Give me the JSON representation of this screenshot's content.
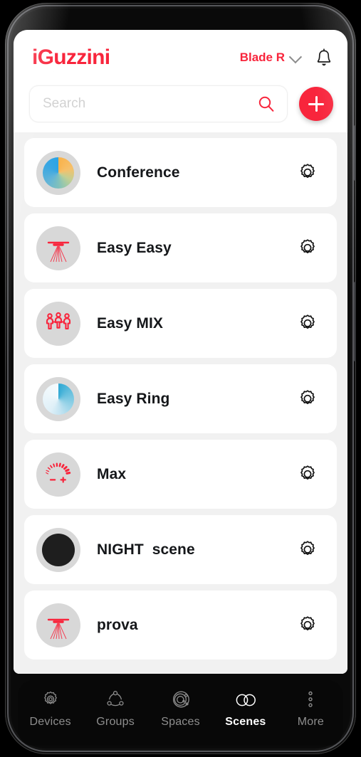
{
  "app": {
    "brand_logo_text": "iGuzzini",
    "brand_color": "#f8253c",
    "page_background": "#f1f1f1",
    "card_background": "#ffffff"
  },
  "header": {
    "project_name": "Blade R",
    "project_chevron_icon": "chevron-down-icon",
    "notifications_icon": "bell-icon"
  },
  "search": {
    "value": "",
    "placeholder": "Search",
    "search_icon": "search-icon",
    "add_label": "+",
    "add_icon": "plus-icon"
  },
  "scenes": [
    {
      "label": "Conference",
      "thumb_icon": "pie-chart-warm-cool-icon",
      "settings_icon": "gear-icon"
    },
    {
      "label": "Easy Easy",
      "thumb_icon": "downlight-beam-icon",
      "settings_icon": "gear-icon"
    },
    {
      "label": "Easy MIX",
      "thumb_icon": "people-group-icon",
      "settings_icon": "gear-icon"
    },
    {
      "label": "Easy Ring",
      "thumb_icon": "pie-chart-blue-icon",
      "settings_icon": "gear-icon"
    },
    {
      "label": "Max",
      "thumb_icon": "dimmer-gauge-icon",
      "settings_icon": "gear-icon"
    },
    {
      "label": "NIGHT  scene",
      "thumb_icon": "dark-circle-icon",
      "settings_icon": "gear-icon"
    },
    {
      "label": "prova",
      "thumb_icon": "downlight-beam-icon",
      "settings_icon": "gear-icon"
    }
  ],
  "bottom_nav": {
    "active": "Scenes",
    "items": [
      {
        "label": "Devices",
        "icon": "gear-outline-icon"
      },
      {
        "label": "Groups",
        "icon": "nodes-triangle-icon"
      },
      {
        "label": "Spaces",
        "icon": "orbit-rings-icon"
      },
      {
        "label": "Scenes",
        "icon": "two-circles-icon"
      },
      {
        "label": "More",
        "icon": "three-dots-vertical-icon"
      }
    ]
  }
}
